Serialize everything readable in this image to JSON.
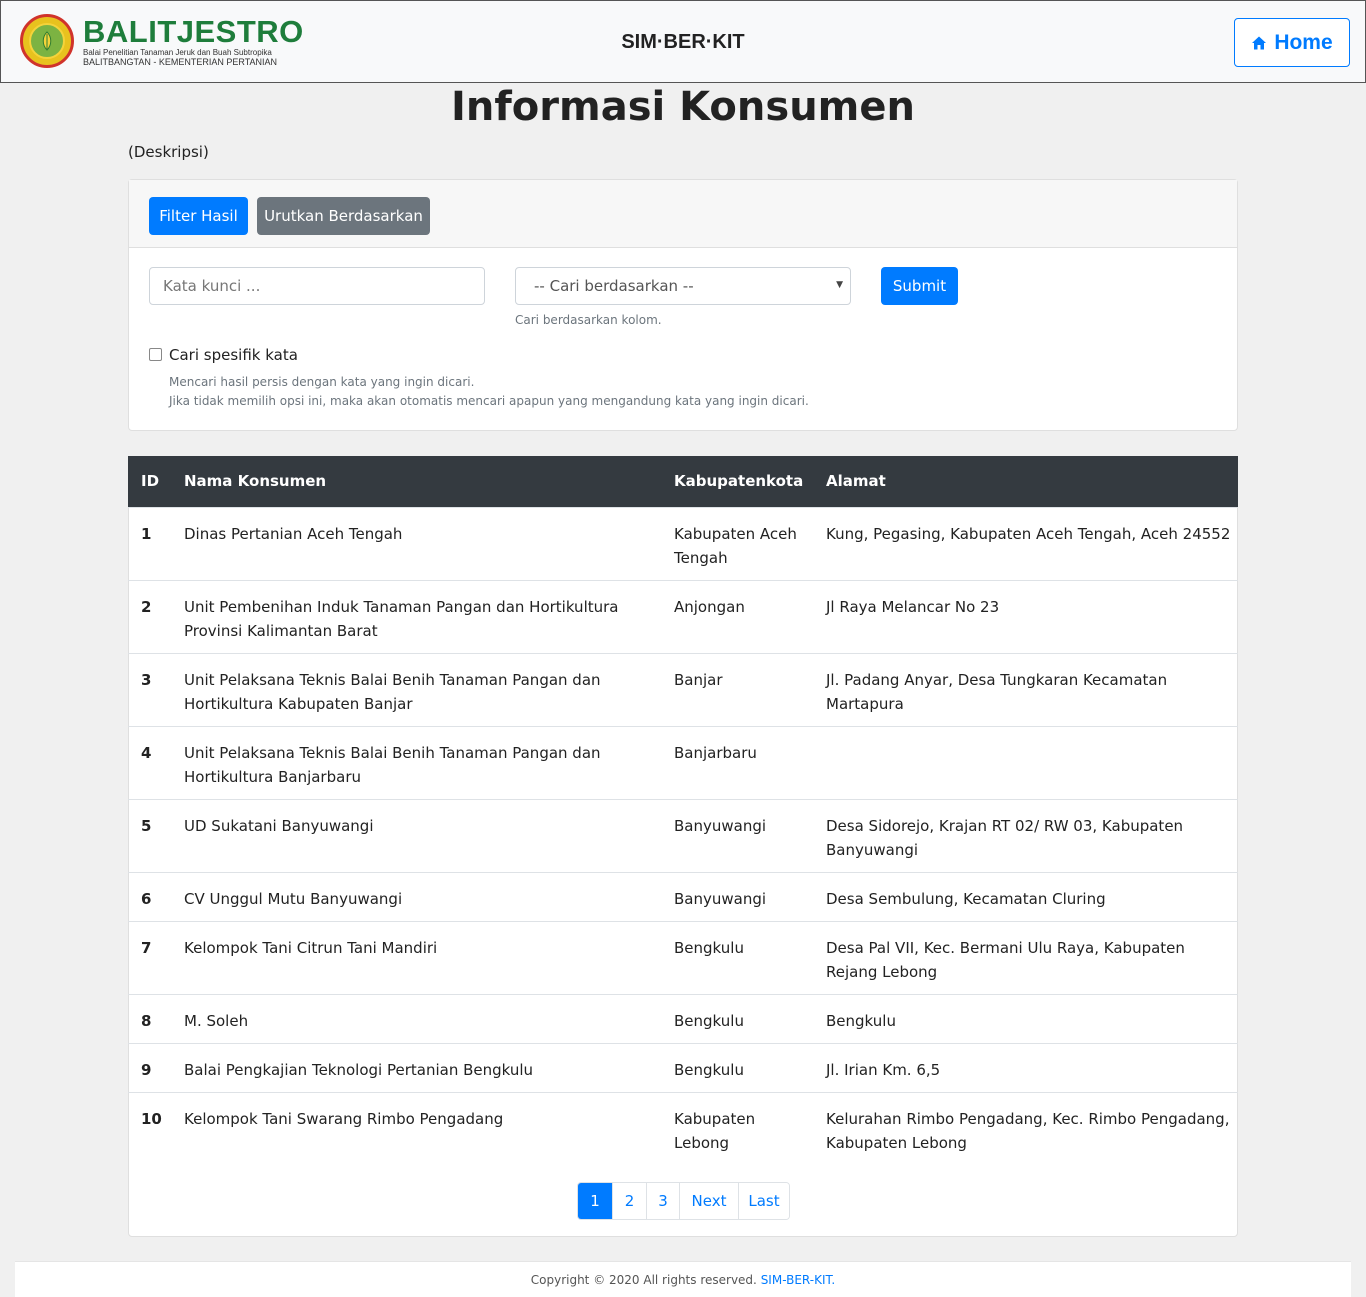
{
  "header": {
    "logo_title": "BALITJESTRO",
    "logo_subtitle": "Balai Penelitian Tanaman Jeruk dan Buah Subtropika",
    "logo_subtitle2": "BALITBANGTAN - KEMENTERIAN PERTANIAN",
    "brand": "SIM·BER·KIT",
    "home_label": "Home"
  },
  "page": {
    "title": "Informasi Konsumen",
    "description": "(Deskripsi)"
  },
  "filter": {
    "filter_btn": "Filter Hasil",
    "sort_btn": "Urutkan Berdasarkan",
    "keyword_placeholder": "Kata kunci ...",
    "keyword_value": "",
    "search_by_selected": "-- Cari berdasarkan --",
    "search_by_help": "Cari berdasarkan kolom.",
    "submit_label": "Submit",
    "exact_label": "Cari spesifik kata",
    "exact_help1": "Mencari hasil persis dengan kata yang ingin dicari.",
    "exact_help2": "Jika tidak memilih opsi ini, maka akan otomatis mencari apapun yang mengandung kata yang ingin dicari."
  },
  "table": {
    "columns": [
      "ID",
      "Nama Konsumen",
      "Kabupatenkota",
      "Alamat"
    ],
    "rows": [
      {
        "id": "1",
        "nama": "Dinas Pertanian Aceh Tengah",
        "kab": "Kabupaten Aceh Tengah",
        "alamat": "Kung, Pegasing, Kabupaten Aceh Tengah, Aceh 24552"
      },
      {
        "id": "2",
        "nama": "Unit Pembenihan Induk Tanaman Pangan dan Hortikultura Provinsi Kalimantan Barat",
        "kab": "Anjongan",
        "alamat": "Jl Raya Melancar No 23"
      },
      {
        "id": "3",
        "nama": "Unit Pelaksana Teknis Balai Benih Tanaman Pangan dan Hortikultura Kabupaten Banjar",
        "kab": "Banjar",
        "alamat": "Jl. Padang Anyar, Desa Tungkaran Kecamatan Martapura"
      },
      {
        "id": "4",
        "nama": "Unit Pelaksana Teknis Balai Benih Tanaman Pangan dan Hortikultura Banjarbaru",
        "kab": "Banjarbaru",
        "alamat": ""
      },
      {
        "id": "5",
        "nama": "UD Sukatani Banyuwangi",
        "kab": "Banyuwangi",
        "alamat": "Desa Sidorejo, Krajan RT 02/ RW 03, Kabupaten Banyuwangi"
      },
      {
        "id": "6",
        "nama": "CV Unggul Mutu Banyuwangi",
        "kab": "Banyuwangi",
        "alamat": "Desa Sembulung, Kecamatan Cluring"
      },
      {
        "id": "7",
        "nama": "Kelompok Tani Citrun Tani Mandiri",
        "kab": "Bengkulu",
        "alamat": "Desa Pal VII, Kec. Bermani Ulu Raya, Kabupaten Rejang Lebong"
      },
      {
        "id": "8",
        "nama": "M. Soleh",
        "kab": "Bengkulu",
        "alamat": "Bengkulu"
      },
      {
        "id": "9",
        "nama": "Balai Pengkajian Teknologi Pertanian Bengkulu",
        "kab": "Bengkulu",
        "alamat": "Jl. Irian Km. 6,5"
      },
      {
        "id": "10",
        "nama": "Kelompok Tani Swarang Rimbo Pengadang",
        "kab": "Kabupaten Lebong",
        "alamat": "Kelurahan Rimbo Pengadang, Kec. Rimbo Pengadang, Kabupaten Lebong"
      }
    ]
  },
  "pagination": {
    "pages": [
      "1",
      "2",
      "3"
    ],
    "next": "Next",
    "last": "Last",
    "active": "1"
  },
  "footer": {
    "text": "Copyright © 2020 All rights reserved.",
    "link": "SIM-BER-KIT."
  },
  "colors": {
    "primary": "#007bff",
    "secondary": "#6c757d",
    "table_header": "#343a40",
    "logo_green": "#1e7d3b"
  }
}
